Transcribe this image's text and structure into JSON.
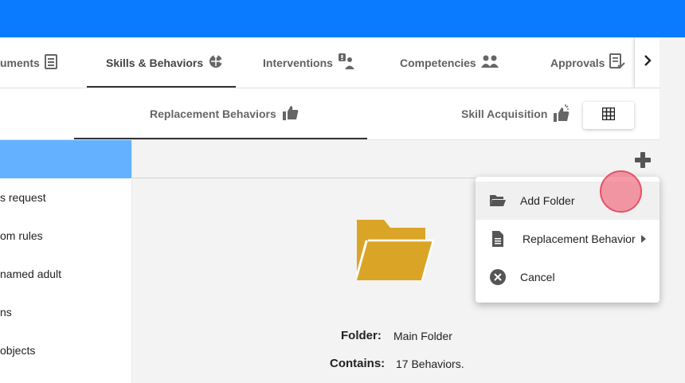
{
  "colors": {
    "topbar": "#0a7bff",
    "selected_folder": "#64b1ff",
    "folder_icon": "#daa526",
    "cursor": "#e8506a"
  },
  "tabs": [
    {
      "label": "uments",
      "icon": "document-icon"
    },
    {
      "label": "Skills & Behaviors",
      "icon": "puzzle-icon",
      "active": true
    },
    {
      "label": "Interventions",
      "icon": "person-alert-icon"
    },
    {
      "label": "Competencies",
      "icon": "group-icon"
    },
    {
      "label": "Approvals",
      "icon": "approval-doc-icon"
    }
  ],
  "subtabs": [
    {
      "label": "Replacement Behaviors",
      "icon": "thumbs-up-icon",
      "active": true
    },
    {
      "label": "Skill Acquisition",
      "icon": "thumbs-up-sparkle-icon"
    }
  ],
  "sidebar": {
    "items": [
      {
        "label": ""
      },
      {
        "label": "s request"
      },
      {
        "label": "om rules"
      },
      {
        "label": "named adult"
      },
      {
        "label": "ns"
      },
      {
        "label": "objects"
      }
    ]
  },
  "folder_info": {
    "folder_label": "Folder:",
    "folder_value": "Main Folder",
    "contains_label": "Contains:",
    "contains_value": "17 Behaviors."
  },
  "menu": {
    "items": [
      {
        "label": "Add Folder",
        "icon": "folder-open-icon"
      },
      {
        "label": "Replacement Behavior",
        "icon": "document-icon",
        "has_submenu": true
      },
      {
        "label": "Cancel",
        "icon": "cancel-icon"
      }
    ]
  }
}
